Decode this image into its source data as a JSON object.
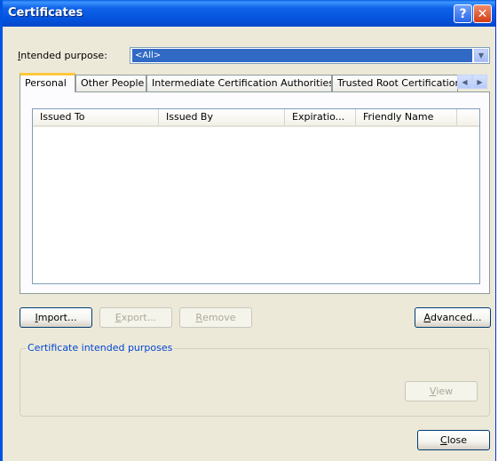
{
  "window": {
    "title": "Certificates",
    "help_glyph": "?",
    "close_glyph": "✕"
  },
  "purpose": {
    "label_first": "I",
    "label_rest": "ntended purpose:",
    "value": "<All>",
    "dropdown_glyph": "▼"
  },
  "tabs": [
    {
      "label": "Personal",
      "active": true
    },
    {
      "label": "Other People",
      "active": false
    },
    {
      "label": "Intermediate Certification Authorities",
      "active": false
    },
    {
      "label": "Trusted Root Certification Authorities",
      "active": false
    }
  ],
  "tab_scroll": {
    "left_glyph": "◀",
    "right_glyph": "▶"
  },
  "list": {
    "columns": [
      "Issued To",
      "Issued By",
      "Expiratio...",
      "Friendly Name"
    ],
    "rows": []
  },
  "buttons": {
    "import_mnemonic": "I",
    "import_rest": "mport...",
    "export_mnemonic": "E",
    "export_rest": "xport...",
    "remove_mnemonic": "R",
    "remove_rest": "emove",
    "advanced_mnemonic": "A",
    "advanced_rest": "dvanced...",
    "view_mnemonic": "V",
    "view_rest": "iew",
    "close_mnemonic": "C",
    "close_rest": "lose"
  },
  "intended_purposes": {
    "title": "Certificate intended purposes",
    "value": ""
  },
  "colors": {
    "title_bar": "#0553dd",
    "selection": "#316ac5",
    "group_title": "#0046d5",
    "dialog_bg": "#ece9d8"
  }
}
